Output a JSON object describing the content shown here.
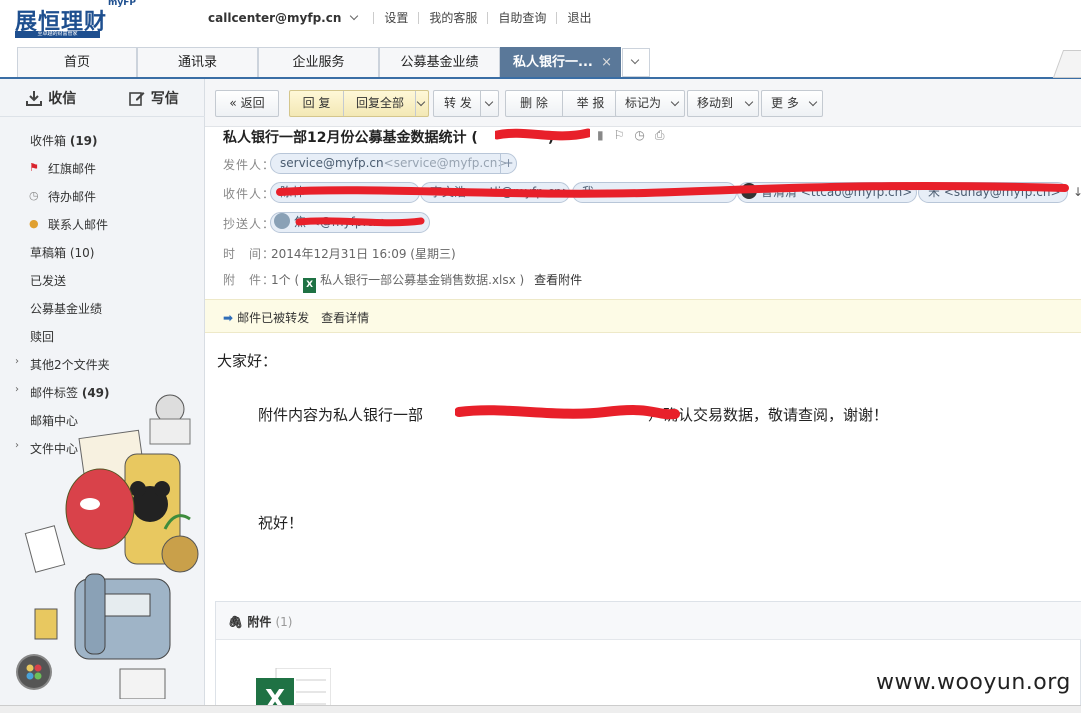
{
  "brand": {
    "name_cn": "展恒理财",
    "name_en": "myFP",
    "tagline": "至卓越的财富管家"
  },
  "top_links": {
    "account": "callcenter@myfp.cn",
    "settings": "设置",
    "my_service": "我的客服",
    "self_query": "自助查询",
    "logout": "退出"
  },
  "tabs": [
    {
      "label": "首页"
    },
    {
      "label": "通讯录"
    },
    {
      "label": "企业服务"
    },
    {
      "label": "公募基金业绩"
    },
    {
      "label": "私人银行一...",
      "close": "×"
    }
  ],
  "compose": {
    "inbox": "收信",
    "write": "写信"
  },
  "folders": {
    "inbox": {
      "label": "收件箱",
      "count": "(19)"
    },
    "flagged": "红旗邮件",
    "todo": "待办邮件",
    "contacts": "联系人邮件",
    "drafts": "草稿箱 (10)",
    "sent": "已发送",
    "fund_perf": "公募基金业绩",
    "junk": "赎回",
    "other": "其他2个文件夹",
    "tags": {
      "label": "邮件标签",
      "count": "(49)"
    },
    "mail_center": "邮箱中心",
    "file_center": "文件中心"
  },
  "toolbar": {
    "back": "返回",
    "reply": "回 复",
    "reply_all": "回复全部",
    "forward": "转 发",
    "delete": "删 除",
    "report": "举 报",
    "mark_as": "标记为",
    "move_to": "移动到",
    "more": "更 多"
  },
  "message": {
    "subject": "私人银行一部12月份公募基金数据统计 (",
    "subject_tail": ")",
    "from_label": "发件人：",
    "from_name": "service@myfp.cn",
    "from_addr": "<service@myfp.cn>",
    "to_label": "收件人：",
    "to": [
      "陈林",
      "李文浩 <wtli@myfp.cn>",
      "我",
      "曹清清 <ttcao@myfp.cn>",
      "宋 <sunay@myfp.cn>"
    ],
    "cc_label": "抄送人：",
    "cc": [
      "焦 <@myfp.cn>"
    ],
    "time_label": "时　间：",
    "time": "2014年12月31日 16:09 (星期三)",
    "attach_label": "附　件：",
    "attach_count": "1个 (",
    "attach_file": "私人银行一部公募基金销售数据.xlsx )",
    "attach_view": "查看附件"
  },
  "notice": {
    "text": "邮件已被转发",
    "link": "查看详情"
  },
  "body": {
    "greeting": "大家好：",
    "line1_a": "附件内容为私人银行一部",
    "line1_b": "）确认交易数据，敬请查阅，谢谢！",
    "closing": "祝好！"
  },
  "attachments": {
    "title": "附件",
    "count": "(1)",
    "file_icon_letter": "X"
  },
  "watermark": "www.wooyun.org",
  "colors": {
    "accent": "#3a6ea5",
    "tab_active": "#5a7899",
    "excel_green": "#1f7244",
    "redact_red": "#e8202a"
  }
}
